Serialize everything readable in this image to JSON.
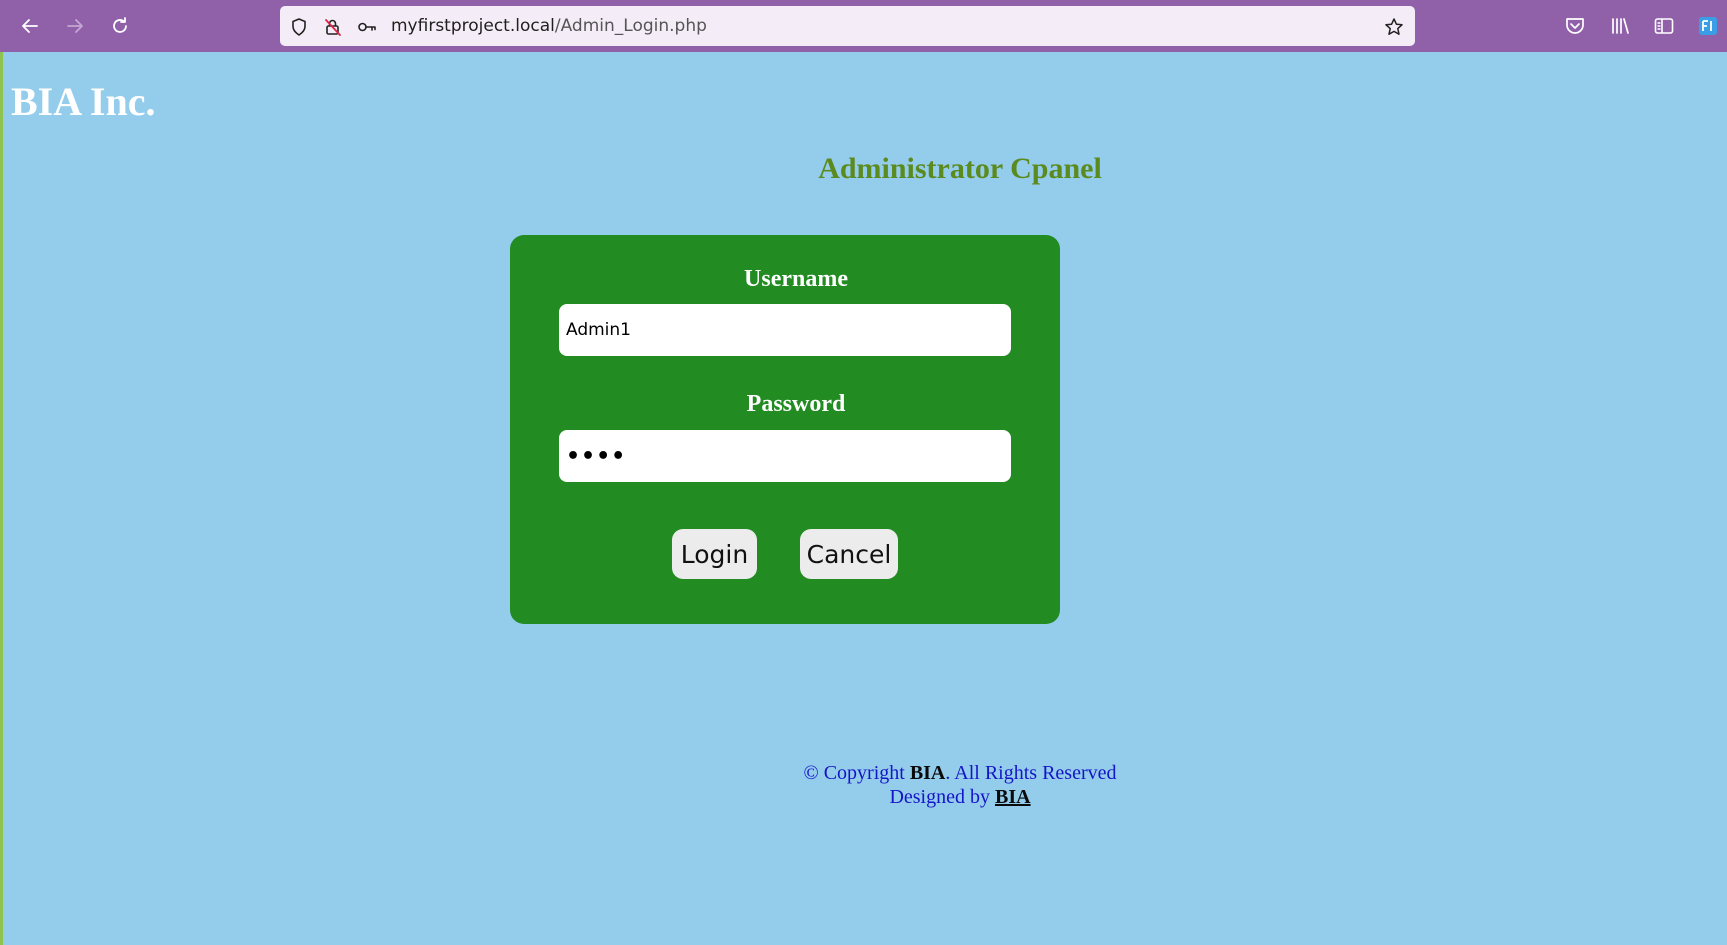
{
  "browser": {
    "url_host": "myfirstproject.local",
    "url_path": "/Admin_Login.php",
    "icons": {
      "back": "back-arrow-icon",
      "forward": "forward-arrow-icon",
      "reload": "reload-icon",
      "tracking": "shield-icon",
      "permissions": "blocked-permission-icon",
      "key": "key-icon",
      "bookmark": "star-icon",
      "pocket": "pocket-icon",
      "library": "library-icon",
      "sidebar": "sidebar-icon",
      "extension": "extension-icon"
    },
    "colors": {
      "toolbar": "#9061a9",
      "url_bar": "#f4ecf6"
    }
  },
  "page": {
    "brand": "BIA Inc.",
    "title": "Administrator Cpanel",
    "colors": {
      "background": "#94cceb",
      "panel": "#228b22",
      "title": "#5b8b1f",
      "footer_text": "#1515c8"
    }
  },
  "login_form": {
    "username_label": "Username",
    "username_value": "Admin1",
    "password_label": "Password",
    "password_value": "••••",
    "login_label": "Login",
    "cancel_label": "Cancel"
  },
  "footer": {
    "copyright_prefix": "© Copyright ",
    "copyright_brand": "BIA",
    "copyright_suffix": ". All Rights Reserved",
    "designed_prefix": "Designed by ",
    "designed_link": "BIA"
  }
}
